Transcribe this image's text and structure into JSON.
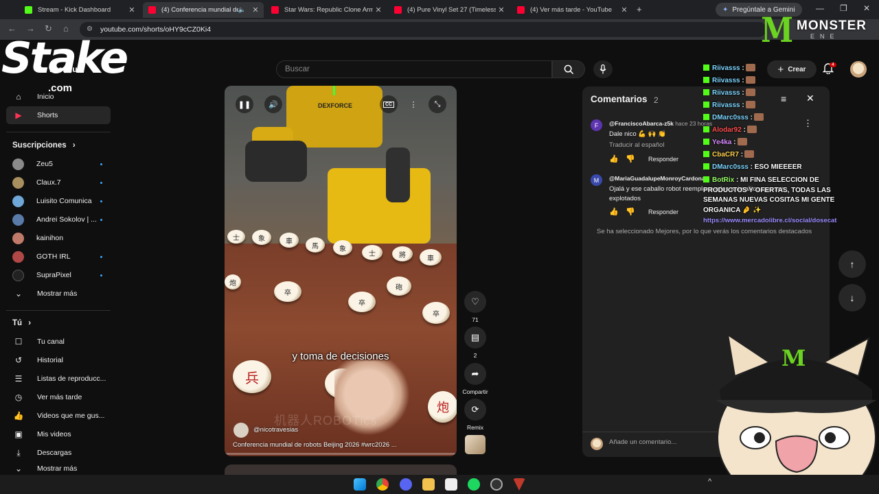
{
  "browser": {
    "tabs": [
      {
        "title": "Stream - Kick Dashboard",
        "fav_color": "#53fc18"
      },
      {
        "title": "(4) Conferencia mundial de",
        "fav_color": "#ff0033"
      },
      {
        "title": "Star Wars: Republic Clone Army",
        "fav_color": "#ff0033"
      },
      {
        "title": "(4) Pure Vinyl Set 27 (Timeless",
        "fav_color": "#ff0033"
      },
      {
        "title": "(4) Ver más tarde - YouTube",
        "fav_color": "#ff0033"
      }
    ],
    "new_tab": "+",
    "gemini_label": "Pregúntale a Gemini",
    "url": "youtube.com/shorts/oHY9cCZ0Ki4"
  },
  "header": {
    "search_placeholder": "Buscar",
    "create_label": "Crear",
    "notification_count": "4"
  },
  "overlay": {
    "stake_logo": "Stake",
    "stake_suffix": ".com",
    "premium_fragment": "Premiu",
    "monster_mark": "M",
    "monster_word": "MONSTER",
    "monster_sub": "ENE"
  },
  "sidebar": {
    "main": [
      {
        "label": "Inicio",
        "icon": "home-icon"
      },
      {
        "label": "Shorts",
        "icon": "shorts-icon"
      }
    ],
    "subscriptions_heading": "Suscripciones",
    "subscriptions": [
      {
        "label": "Zeu5",
        "color": "#8a8a8a"
      },
      {
        "label": "Claux.7",
        "color": "#a8905e"
      },
      {
        "label": "Luisito Comunica",
        "color": "#6fa8d8"
      },
      {
        "label": "Andrei Sokolov | ...",
        "color": "#5a7aa8"
      },
      {
        "label": "kainihon",
        "color": "#c07a6a"
      },
      {
        "label": "GOTH IRL",
        "color": "#b04848"
      },
      {
        "label": "SupraPixel",
        "color": "#222222"
      }
    ],
    "show_more": "Mostrar más",
    "you_heading": "Tú",
    "you": [
      {
        "label": "Tu canal",
        "icon": "channel-icon"
      },
      {
        "label": "Historial",
        "icon": "history-icon"
      },
      {
        "label": "Listas de reproducc...",
        "icon": "playlist-icon"
      },
      {
        "label": "Ver más tarde",
        "icon": "clock-icon"
      },
      {
        "label": "Videos que me gus...",
        "icon": "like-icon"
      },
      {
        "label": "Mis videos",
        "icon": "video-icon"
      },
      {
        "label": "Descargas",
        "icon": "download-icon"
      }
    ],
    "show_more_2": "Mostrar más"
  },
  "video": {
    "brand_text": "DEXFORCE",
    "caption": "y toma de decisiones",
    "watermark": "机器人ROBOTics",
    "channel": "@nicotravesias",
    "title": "Conferencia mundial de robots Beijing 2026 #wrc2026 ...",
    "progress": 0.0,
    "cc": "CC"
  },
  "actions": {
    "likes": "71",
    "comments": "2",
    "share": "Compartir",
    "remix": "Remix"
  },
  "comments": {
    "title": "Comentarios",
    "count": "2",
    "items": [
      {
        "avatar_letter": "F",
        "avatar_color": "#5e35b1",
        "user": "@FranciscoAbarca-z5k",
        "time": "hace 23 horas",
        "text": "Dale nico 💪 🙌 👏",
        "translate": "Traducir al español",
        "reply": "Responder"
      },
      {
        "avatar_letter": "M",
        "avatar_color": "#3949ab",
        "user": "@MariaGuadalupeMonroyCardona",
        "time": "",
        "text": "Ojalá y  ese caballo robot reemplace a los animalitos que son explotados",
        "reply": "Responder"
      }
    ],
    "note": "Se ha seleccionado Mejores, por lo que verás los comentarios destacados",
    "input_placeholder": "Añade un comentario..."
  },
  "chat": [
    {
      "user": "Riivasss",
      "color": "#7fd6ff",
      "msg": ":"
    },
    {
      "user": "Riivasss",
      "color": "#7fd6ff",
      "msg": ":"
    },
    {
      "user": "Riivasss",
      "color": "#7fd6ff",
      "msg": ":"
    },
    {
      "user": "Riivasss",
      "color": "#7fd6ff",
      "msg": ":"
    },
    {
      "user": "DMarc0sss",
      "color": "#7fd6ff",
      "msg": ":"
    },
    {
      "user": "Alodar92",
      "color": "#ff4e4e",
      "msg": ":"
    },
    {
      "user": "Ye4ka",
      "color": "#d98cff",
      "msg": ":"
    },
    {
      "user": "CbaCR7",
      "color": "#ffd24e",
      "msg": ":"
    },
    {
      "user": "DMarc0sss",
      "color": "#7fd6ff",
      "msg": ": ESO MIEEEER"
    },
    {
      "user": "BotRix",
      "color": "#9cff6b",
      "msg": ": MI FINA SELECCION DE PRODUCTOS Y OFERTAS, TODAS LAS SEMANAS NUEVAS COSITAS MI GENTE ORGANICA 🤌 ✨"
    }
  ],
  "chat_link": "https://www.mercadolibre.cl/social/dosecat",
  "colors": {
    "kick_green": "#53fc18",
    "yt_red": "#ff0033",
    "monster_green": "#6bd321"
  }
}
